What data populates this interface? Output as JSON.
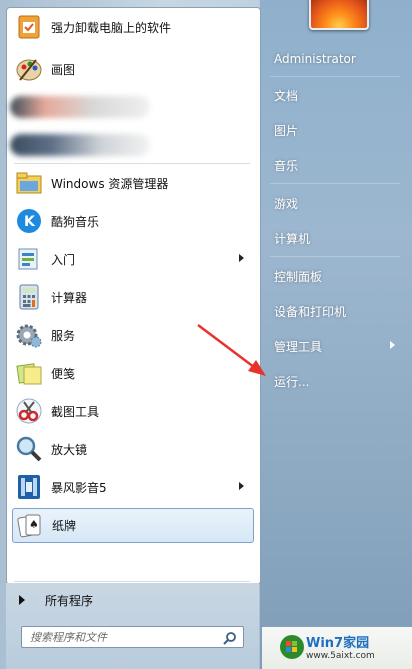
{
  "pinned": [
    {
      "label": "强力卸载电脑上的软件",
      "icon": "uninstaller-icon"
    },
    {
      "label": "画图",
      "icon": "paint-icon"
    }
  ],
  "recent": [
    {
      "label": "Windows 资源管理器",
      "icon": "explorer-folder-icon",
      "submenu": false
    },
    {
      "label": "酷狗音乐",
      "icon": "kugou-icon",
      "submenu": false
    },
    {
      "label": "入门",
      "icon": "getting-started-icon",
      "submenu": true
    },
    {
      "label": "计算器",
      "icon": "calculator-icon",
      "submenu": false
    },
    {
      "label": "服务",
      "icon": "services-gear-icon",
      "submenu": false
    },
    {
      "label": "便笺",
      "icon": "sticky-notes-icon",
      "submenu": false
    },
    {
      "label": "截图工具",
      "icon": "snipping-tool-icon",
      "submenu": false
    },
    {
      "label": "放大镜",
      "icon": "magnifier-icon",
      "submenu": false
    },
    {
      "label": "暴风影音5",
      "icon": "baofeng-icon",
      "submenu": true
    },
    {
      "label": "纸牌",
      "icon": "solitaire-icon",
      "submenu": false,
      "selected": true
    }
  ],
  "all_programs": "所有程序",
  "search": {
    "placeholder": "搜索程序和文件"
  },
  "right": [
    {
      "label": "Administrator"
    },
    {
      "label": "文档"
    },
    {
      "label": "图片"
    },
    {
      "label": "音乐"
    },
    {
      "label": "游戏"
    },
    {
      "label": "计算机"
    },
    {
      "label": "控制面板"
    },
    {
      "label": "设备和打印机"
    },
    {
      "label": "管理工具",
      "submenu": true
    },
    {
      "label": "运行..."
    }
  ],
  "watermark": {
    "brand": "Win7家园",
    "url": "www.5aixt.com"
  },
  "colors": {
    "annotation_arrow": "#e8322b",
    "selection_border": "#7da2ce",
    "pane_blue": "#8fb0cc"
  }
}
